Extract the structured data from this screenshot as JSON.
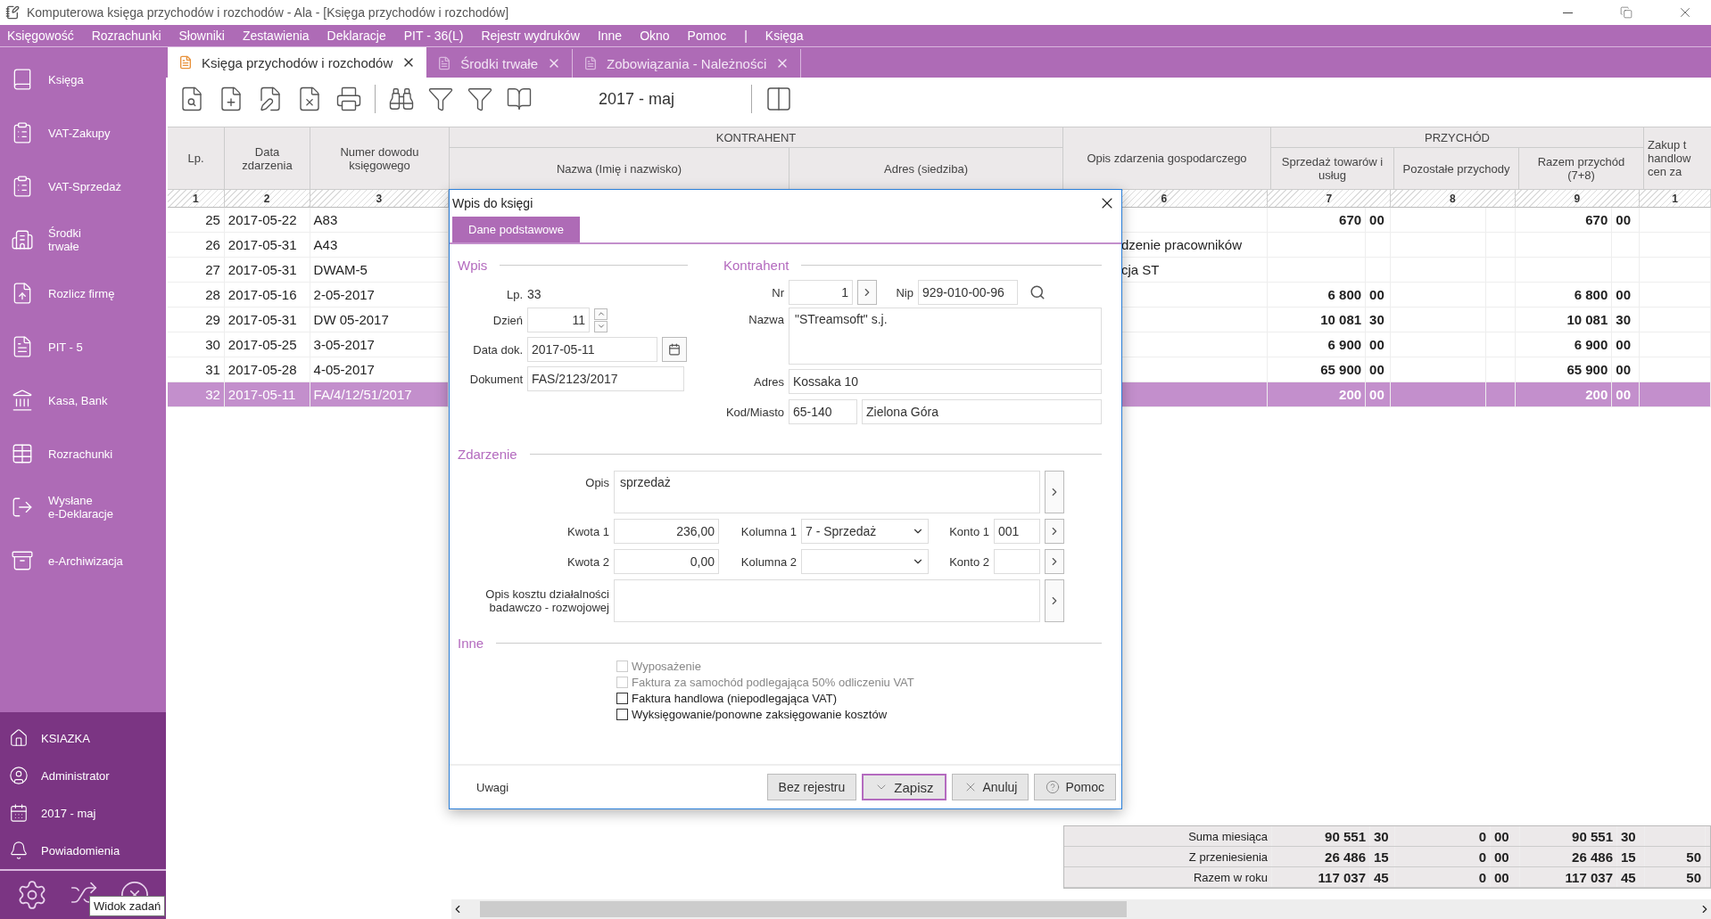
{
  "window": {
    "title": "Komputerowa księga przychodów i rozchodów - Ala - [Księga przychodów i rozchodów]"
  },
  "menu": [
    "Księgowość",
    "Rozrachunki",
    "Słowniki",
    "Zestawienia",
    "Deklaracje",
    "PIT - 36(L)",
    "Rejestr wydruków",
    "Inne",
    "Okno",
    "Pomoc",
    "|",
    "Księga"
  ],
  "sidebar": {
    "items": [
      {
        "label": "Księga",
        "kind": "book"
      },
      {
        "label": "VAT-Zakupy",
        "kind": "clipboard"
      },
      {
        "label": "VAT-Sprzedaż",
        "kind": "clipboard"
      },
      {
        "label": "Środki\ntrwałe",
        "kind": "building"
      },
      {
        "label": "Rozlicz firmę",
        "kind": "upload"
      },
      {
        "label": "PIT - 5",
        "kind": "doc"
      },
      {
        "label": "Kasa, Bank",
        "kind": "safe"
      },
      {
        "label": "Rozrachunki",
        "kind": "table"
      },
      {
        "label": "Wysłane\ne-Deklaracje",
        "kind": "send"
      },
      {
        "label": "e-Archiwizacja",
        "kind": "archive"
      }
    ],
    "status": [
      {
        "label": "KSIAZKA",
        "kind": "home"
      },
      {
        "label": "Administrator",
        "kind": "user"
      },
      {
        "label": "2017  - maj",
        "kind": "calendar"
      },
      {
        "label": "Powiadomienia",
        "kind": "bell"
      }
    ]
  },
  "tabs": [
    {
      "label": "Księga przychodów i rozchodów",
      "selected": true
    },
    {
      "label": "Środki trwałe",
      "selected": false
    },
    {
      "label": "Zobowiązania - Należności",
      "selected": false
    }
  ],
  "toolbar": {
    "period": "2017 - maj"
  },
  "table": {
    "headers": {
      "lp": "Lp.",
      "date": "Data zdarzenia",
      "doc": "Numer dowodu księgowego",
      "contractor": "KONTRAHENT",
      "name": "Nazwa (Imię i nazwisko)",
      "address": "Adres (siedziba)",
      "desc": "Opis zdarzenia gospodarczego",
      "income": "PRZYCHÓD",
      "sales": "Sprzedaż towarów i usług",
      "other": "Pozostałe przychody",
      "total": "Razem przychód (7+8)",
      "purchase": "Zakup t\nhandlow\ncen za"
    },
    "numbers": [
      "1",
      "2",
      "3",
      "6",
      "7",
      "8",
      "9",
      "1"
    ],
    "rows": [
      {
        "lp": "25",
        "date": "2017-05-22",
        "doc": "A83",
        "desc": "",
        "sales": [
          "670",
          "00"
        ],
        "total": [
          "670",
          "00"
        ],
        "selected": false
      },
      {
        "lp": "26",
        "date": "2017-05-31",
        "doc": "A43",
        "desc": "dzenie pracowników",
        "sales": null,
        "total": null,
        "selected": false
      },
      {
        "lp": "27",
        "date": "2017-05-31",
        "doc": "DWAM-5",
        "desc": "cja ST",
        "sales": null,
        "total": null,
        "selected": false
      },
      {
        "lp": "28",
        "date": "2017-05-16",
        "doc": "2-05-2017",
        "desc": "",
        "sales": [
          "6 800",
          "00"
        ],
        "total": [
          "6 800",
          "00"
        ],
        "selected": false
      },
      {
        "lp": "29",
        "date": "2017-05-31",
        "doc": "DW 05-2017",
        "desc": "",
        "sales": [
          "10 081",
          "30"
        ],
        "total": [
          "10 081",
          "30"
        ],
        "selected": false
      },
      {
        "lp": "30",
        "date": "2017-05-25",
        "doc": "3-05-2017",
        "desc": "",
        "sales": [
          "6 900",
          "00"
        ],
        "total": [
          "6 900",
          "00"
        ],
        "selected": false
      },
      {
        "lp": "31",
        "date": "2017-05-28",
        "doc": "4-05-2017",
        "desc": "",
        "sales": [
          "65 900",
          "00"
        ],
        "total": [
          "65 900",
          "00"
        ],
        "selected": false
      },
      {
        "lp": "32",
        "date": "2017-05-11",
        "doc": "FA/4/12/51/2017",
        "desc": "",
        "sales": [
          "200",
          "00"
        ],
        "total": [
          "200",
          "00"
        ],
        "selected": true
      }
    ],
    "totals": [
      {
        "label": "Suma miesiąca",
        "sales": [
          "90 551",
          "30"
        ],
        "other": [
          "0",
          "00"
        ],
        "total": [
          "90 551",
          "30"
        ]
      },
      {
        "label": "Z przeniesienia",
        "sales": [
          "26 486",
          "15"
        ],
        "other": [
          "0",
          "00"
        ],
        "total": [
          "26 486",
          "15"
        ],
        "purchase": "50"
      },
      {
        "label": "Razem w roku",
        "sales": [
          "117 037",
          "45"
        ],
        "other": [
          "0",
          "00"
        ],
        "total": [
          "117 037",
          "45"
        ],
        "purchase": "50"
      }
    ]
  },
  "dialog": {
    "title": "Wpis do księgi",
    "tab": "Dane podstawowe",
    "wpis": {
      "title": "Wpis",
      "lp_label": "Lp.",
      "lp": "33",
      "day_label": "Dzień",
      "day": "11",
      "date_label": "Data dok.",
      "date": "2017-05-11",
      "document_label": "Dokument",
      "document": "FAS/2123/2017"
    },
    "kontrahent": {
      "title": "Kontrahent",
      "nr_label": "Nr",
      "nr": "1",
      "nip_label": "Nip",
      "nip": "929-010-00-96",
      "name_label": "Nazwa",
      "name": "\"STreamsoft\" s.j.",
      "address_label": "Adres",
      "address": "Kossaka 10",
      "city_label": "Kod/Miasto",
      "postcode": "65-140",
      "city": "Zielona Góra"
    },
    "zdarzenie": {
      "title": "Zdarzenie",
      "desc_label": "Opis",
      "desc": "sprzedaż",
      "amounts": [
        {
          "label": "Kwota 1",
          "value": "236,00",
          "column_label": "Kolumna 1",
          "column": "7 - Sprzedaż",
          "account_label": "Konto 1",
          "account": "001"
        },
        {
          "label": "Kwota 2",
          "value": "0,00",
          "column_label": "Kolumna 2",
          "account_label": "Konto 2"
        }
      ],
      "rd_label": "Opis kosztu działalności badawczo - rozwojowej"
    },
    "inne": {
      "title": "Inne",
      "options": [
        {
          "label": "Wyposażenie",
          "checked": false,
          "disabled": true
        },
        {
          "label": "Faktura za samochód podlegająca 50% odliczeniu VAT",
          "checked": false,
          "disabled": true
        },
        {
          "label": "Faktura handlowa (niepodlegająca VAT)",
          "checked": false,
          "disabled": false
        },
        {
          "label": "Wyksięgowanie/ponowne zaksięgowanie kosztów",
          "checked": false,
          "disabled": false
        }
      ]
    },
    "notes_link": "Uwagi",
    "buttons": [
      {
        "label": "Bez rejestru",
        "kind": "plain",
        "default": false
      },
      {
        "label": "Zapisz",
        "kind": "check",
        "default": true
      },
      {
        "label": "Anuluj",
        "kind": "cancel",
        "default": false
      },
      {
        "label": "Pomoc",
        "kind": "help",
        "default": false
      }
    ]
  },
  "tooltip": "Widok zadań"
}
